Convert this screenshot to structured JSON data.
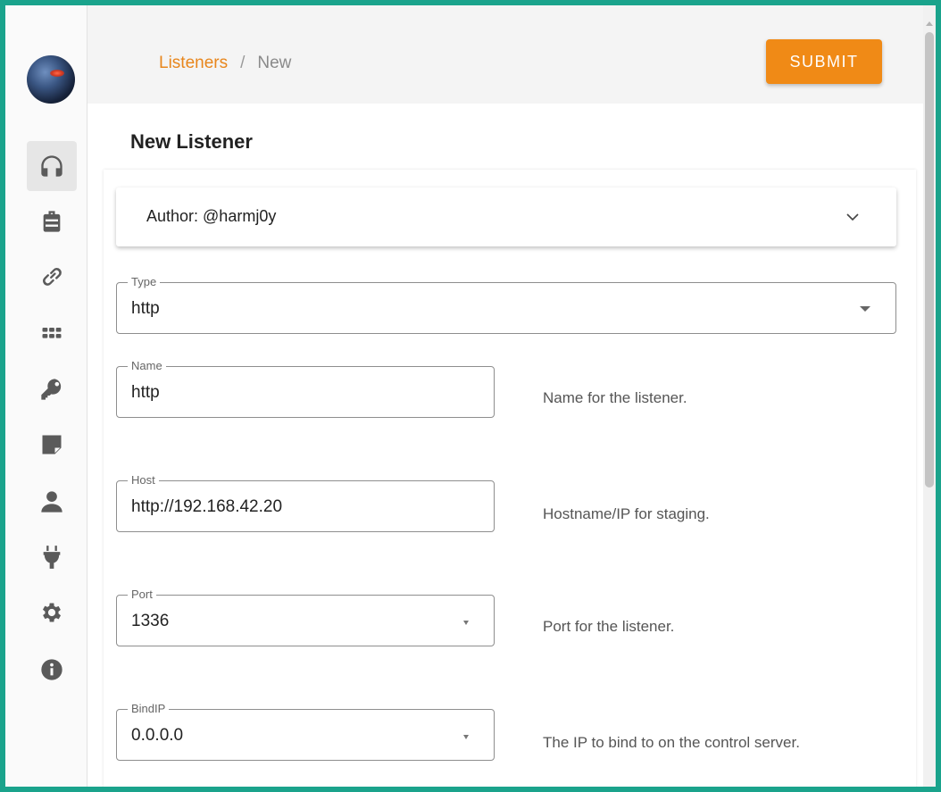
{
  "breadcrumb": {
    "parent": "Listeners",
    "separator": "/",
    "current": "New"
  },
  "submit_label": "SUBMIT",
  "page_title": "New Listener",
  "author_panel": {
    "text": "Author: @harmj0y"
  },
  "fields": {
    "type": {
      "label": "Type",
      "value": "http"
    },
    "name": {
      "label": "Name",
      "value": "http",
      "help": "Name for the listener."
    },
    "host": {
      "label": "Host",
      "value": "http://192.168.42.20",
      "help": "Hostname/IP for staging."
    },
    "port": {
      "label": "Port",
      "value": "1336",
      "help": "Port for the listener."
    },
    "bindip": {
      "label": "BindIP",
      "value": "0.0.0.0",
      "help": "The IP to bind to on the control server."
    }
  },
  "sidebar": {
    "items": [
      {
        "icon": "headphones-icon",
        "active": true
      },
      {
        "icon": "briefcase-icon",
        "active": false
      },
      {
        "icon": "link-icon",
        "active": false
      },
      {
        "icon": "grid-icon",
        "active": false
      },
      {
        "icon": "key-icon",
        "active": false
      },
      {
        "icon": "sticky-note-icon",
        "active": false
      },
      {
        "icon": "user-icon",
        "active": false
      },
      {
        "icon": "plug-icon",
        "active": false
      },
      {
        "icon": "gear-icon",
        "active": false
      },
      {
        "icon": "info-icon",
        "active": false
      }
    ]
  },
  "colors": {
    "accent": "#f08a16",
    "breadcrumb_link": "#e8861c",
    "frame": "#1aa38c"
  }
}
